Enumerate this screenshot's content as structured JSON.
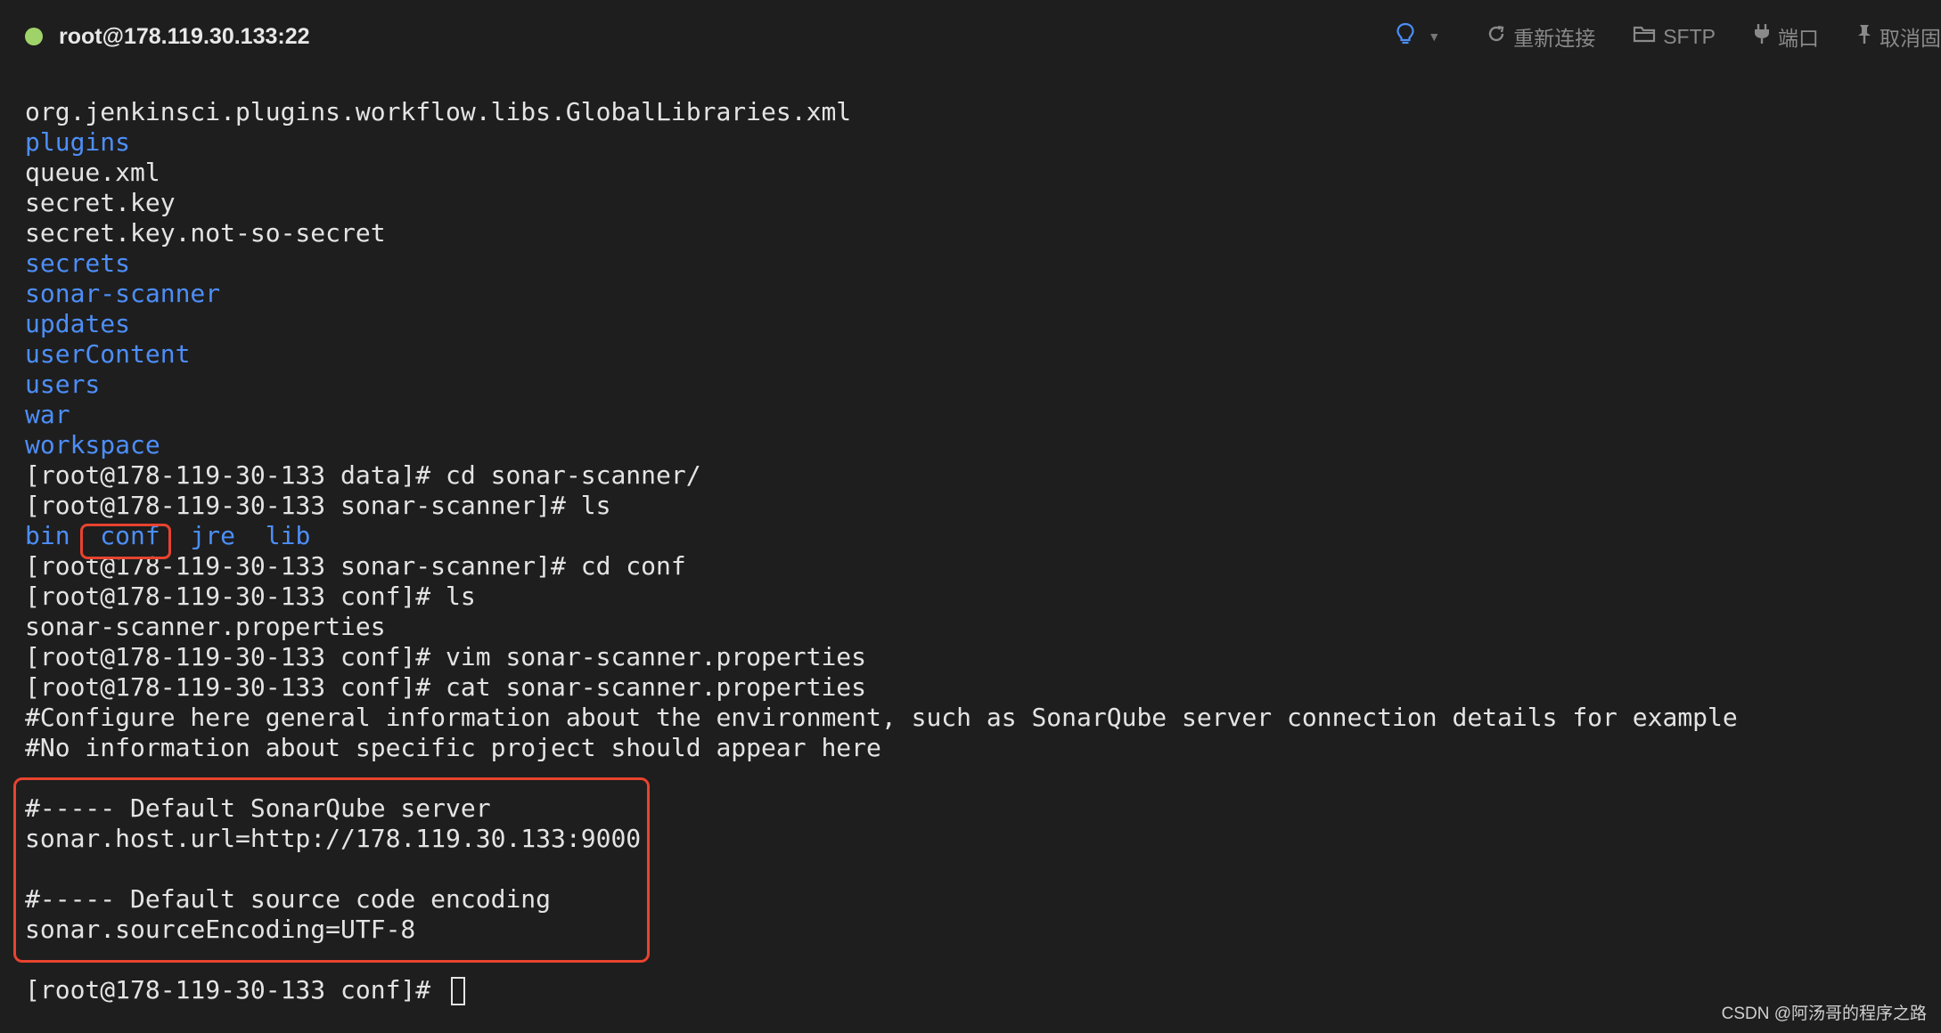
{
  "session": {
    "title": "root@178.119.30.133:22",
    "status_color": "#9fd36a"
  },
  "toolbar": {
    "bulb_icon": "lightbulb-icon",
    "reconnect_label": "重新连接",
    "sftp_label": "SFTP",
    "port_label": "端口",
    "unpin_label": "取消固"
  },
  "terminal": {
    "lines": [
      "org.jenkinsci.plugins.workflow.libs.GlobalLibraries.xml",
      "plugins",
      "queue.xml",
      "secret.key",
      "secret.key.not-so-secret",
      "secrets",
      "sonar-scanner",
      "updates",
      "userContent",
      "users",
      "war",
      "workspace",
      "[root@178-119-30-133 data]# cd sonar-scanner/",
      "[root@178-119-30-133 sonar-scanner]# ls",
      "[root@178-119-30-133 sonar-scanner]# cd conf",
      "[root@178-119-30-133 conf]# ls",
      "sonar-scanner.properties",
      "[root@178-119-30-133 conf]# vim sonar-scanner.properties",
      "[root@178-119-30-133 conf]# cat sonar-scanner.properties",
      "#Configure here general information about the environment, such as SonarQube server connection details for example",
      "#No information about specific project should appear here",
      "#----- Default SonarQube server",
      "sonar.host.url=http://178.119.30.133:9000",
      "#----- Default source code encoding",
      "sonar.sourceEncoding=UTF-8",
      "[root@178-119-30-133 conf]# "
    ],
    "ls_dirs": [
      "bin",
      "conf",
      "jre",
      "lib"
    ],
    "dir_color": "#4d8ef8",
    "text_color": "#e4e4e4"
  },
  "highlight_color": "#e8432f",
  "watermark": "CSDN @阿汤哥的程序之路"
}
